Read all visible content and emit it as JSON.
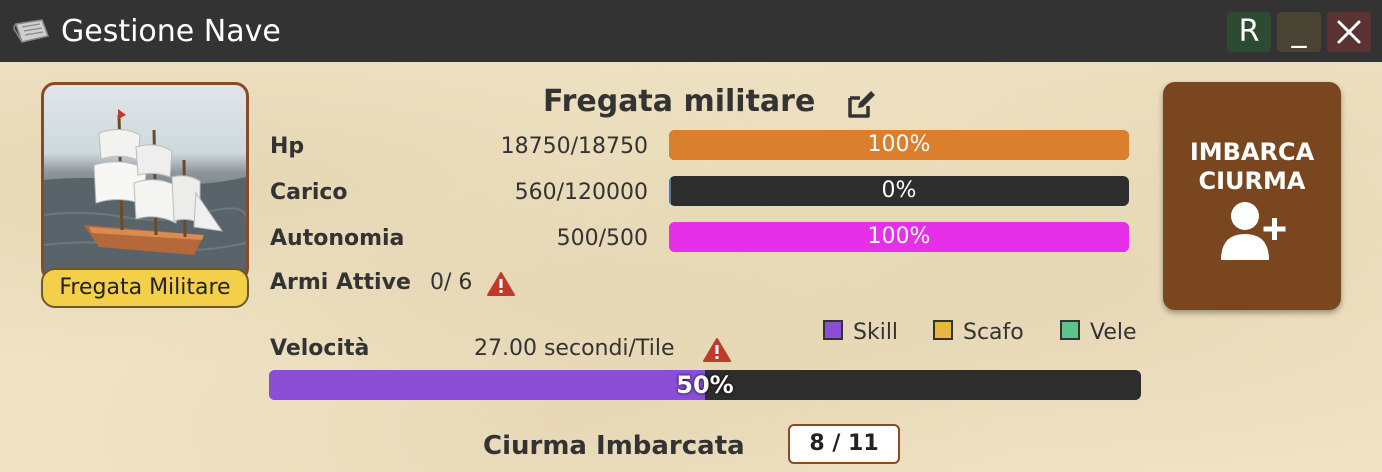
{
  "window": {
    "title": "Gestione Nave",
    "buttons": {
      "reload": "R",
      "minimize": "_"
    }
  },
  "ship": {
    "name": "Fregata militare",
    "type_label": "Fregata Militare"
  },
  "stats": [
    {
      "label": "Hp",
      "value": "18750/18750",
      "percent_text": "100%",
      "fill": 1.0,
      "color": "#d97f2e"
    },
    {
      "label": "Carico",
      "value": "560/120000",
      "percent_text": "0%",
      "fill": 0.005,
      "color": "#3f7fbf"
    },
    {
      "label": "Autonomia",
      "value": "500/500",
      "percent_text": "100%",
      "fill": 1.0,
      "color": "#e52fe8"
    }
  ],
  "armi": {
    "label": "Armi Attive",
    "value": "0/ 6"
  },
  "legend": [
    {
      "label": "Skill",
      "color": "#8a4fd6"
    },
    {
      "label": "Scafo",
      "color": "#e7b83f"
    },
    {
      "label": "Vele",
      "color": "#5cc48a"
    }
  ],
  "speed": {
    "label": "Velocità",
    "value": "27.00 secondi/Tile",
    "percent_text": "50%",
    "fill": 0.5
  },
  "crew": {
    "label": "Ciurma Imbarcata",
    "count": "8 / 11"
  },
  "embark_button": {
    "line1": "IMBARCA",
    "line2": "CIURMA"
  },
  "icons": {
    "title": "scroll-icon",
    "edit": "edit-icon",
    "warning": "warning-icon",
    "embark": "user-plus-icon",
    "close": "close-icon"
  }
}
